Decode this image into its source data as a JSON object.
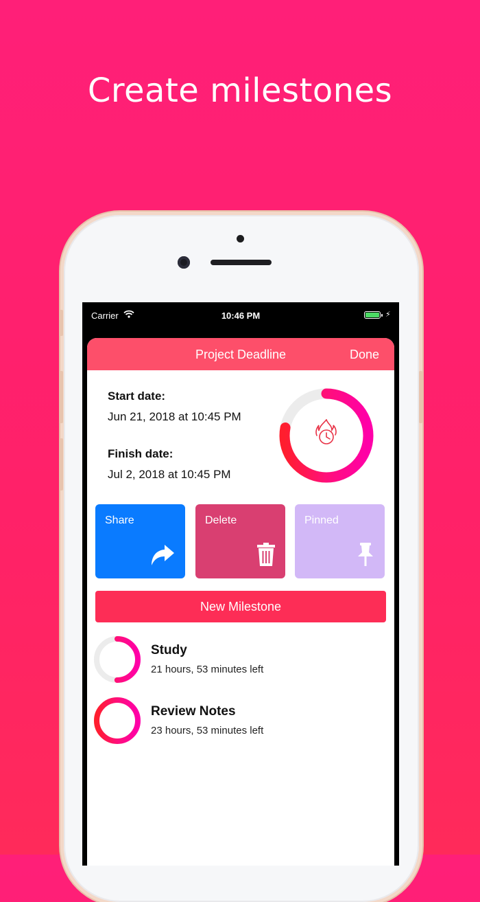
{
  "headline": "Create milestones",
  "status_bar": {
    "carrier": "Carrier",
    "time": "10:46 PM"
  },
  "nav": {
    "title": "Project Deadline",
    "done_label": "Done"
  },
  "dates": {
    "start_label": "Start date:",
    "start_value": "Jun 21, 2018 at 10:45 PM",
    "finish_label": "Finish date:",
    "finish_value": "Jul 2, 2018 at 10:45 PM"
  },
  "progress_ring": {
    "fraction": 0.78,
    "icon": "flame-clock-icon",
    "colors": [
      "#ff1e2e",
      "#ff00a8"
    ]
  },
  "actions": [
    {
      "label": "Share",
      "icon": "share-arrow-icon",
      "color": "#0a7bff"
    },
    {
      "label": "Delete",
      "icon": "trash-icon",
      "color": "#d93f71"
    },
    {
      "label": "Pinned",
      "icon": "pin-icon",
      "color": "#d2b8f7"
    }
  ],
  "new_milestone_label": "New Milestone",
  "milestones": [
    {
      "title": "Study",
      "subtitle": "21 hours, 53 minutes left",
      "progress": 0.5
    },
    {
      "title": "Review Notes",
      "subtitle": "23 hours, 53 minutes left",
      "progress": 1.0
    }
  ],
  "colors": {
    "background": "#ff1f78",
    "accent": "#fd4f6a",
    "button": "#fd2d56"
  }
}
